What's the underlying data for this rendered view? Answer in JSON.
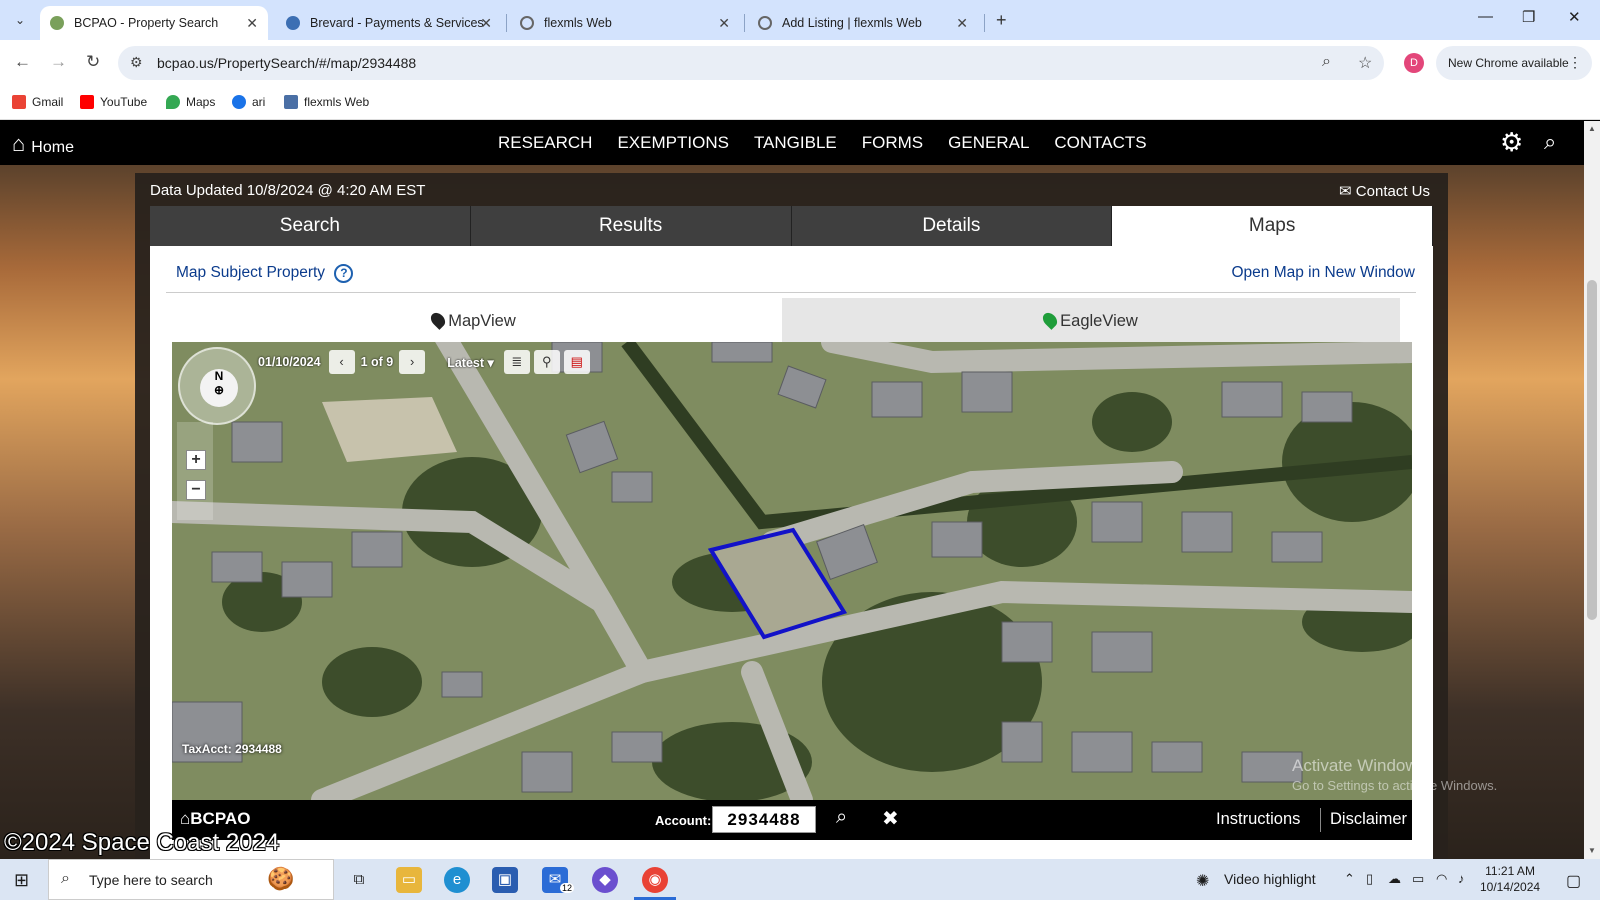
{
  "browser": {
    "tabs": [
      {
        "title": "BCPAO - Property Search",
        "active": true
      },
      {
        "title": "Brevard - Payments & Services",
        "active": false
      },
      {
        "title": "flexmls Web",
        "active": false
      },
      {
        "title": "Add Listing | flexmls Web",
        "active": false
      }
    ],
    "url": "bcpao.us/PropertySearch/#/map/2934488",
    "profile_initial": "D",
    "update_button": "New Chrome available",
    "bookmarks": [
      {
        "label": "Gmail",
        "color": "#ea4335"
      },
      {
        "label": "YouTube",
        "color": "#ff0000"
      },
      {
        "label": "Maps",
        "color": "#34a853"
      },
      {
        "label": "ari",
        "color": "#1a73e8"
      },
      {
        "label": "flexmls Web",
        "color": "#4a6fa5"
      }
    ]
  },
  "site": {
    "home_label": "Home",
    "nav": [
      "RESEARCH",
      "EXEMPTIONS",
      "TANGIBLE",
      "FORMS",
      "GENERAL",
      "CONTACTS"
    ],
    "data_updated": "Data Updated 10/8/2024 @ 4:20 AM EST",
    "contact_us": "Contact Us",
    "main_tabs": [
      {
        "label": "Search",
        "selected": false
      },
      {
        "label": "Results",
        "selected": false
      },
      {
        "label": "Details",
        "selected": false
      },
      {
        "label": "Maps",
        "selected": true
      }
    ],
    "map_subject_property": "Map Subject Property",
    "help_glyph": "?",
    "open_map_new_window": "Open Map in New Window",
    "view_tabs": [
      {
        "label": "MapView",
        "selected": false
      },
      {
        "label": "EagleView",
        "selected": true
      }
    ]
  },
  "map": {
    "image_date": "01/10/2024",
    "image_index": "1 of 9",
    "latest_label": "Latest",
    "compass_label": "N",
    "tax_acct": "TaxAcct: 2934488",
    "footer_logo": "BCPAO",
    "account_label": "Account:",
    "account_value": "2934488",
    "instructions": "Instructions",
    "disclaimer": "Disclaimer",
    "parcel_outline_color": "#1212c8"
  },
  "overlay": {
    "windows_watermark_1": "Activate Windows",
    "windows_watermark_2": "Go to Settings to activate Windows.",
    "copyright": "©2024 Space Coast 2024"
  },
  "taskbar": {
    "search_placeholder": "Type here to search",
    "mail_badge": "12",
    "video_highlight": "Video highlight",
    "time": "11:21 AM",
    "date": "10/14/2024"
  }
}
